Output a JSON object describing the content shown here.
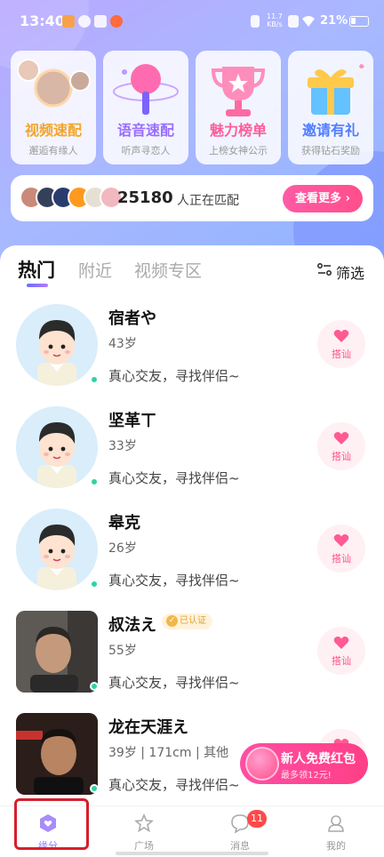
{
  "status_bar": {
    "time": "13:40",
    "net_speed_value": "11.7",
    "net_speed_unit": "KB/s",
    "battery": "21%"
  },
  "feature_cards": [
    {
      "title": "视频速配",
      "subtitle": "邂逅有缘人",
      "color": "#f3a52a"
    },
    {
      "title": "语音速配",
      "subtitle": "听声寻恋人",
      "color": "#9a6dff"
    },
    {
      "title": "魅力榜单",
      "subtitle": "上榜女神公示",
      "color": "#ff5c9a"
    },
    {
      "title": "邀请有礼",
      "subtitle": "获得钻石奖励",
      "color": "#4f7cff"
    }
  ],
  "match_bar": {
    "count": "25180",
    "label": "人正在匹配",
    "more_button": "查看更多"
  },
  "tabs": [
    "热门",
    "附近",
    "视频专区"
  ],
  "filter_label": "筛选",
  "users": [
    {
      "name": "宿者や",
      "age": "43岁",
      "bio": "真心交友，寻找伴侣~",
      "verified": false
    },
    {
      "name": "坚革ㄒ",
      "age": "33岁",
      "bio": "真心交友，寻找伴侣~",
      "verified": false
    },
    {
      "name": "皋克",
      "age": "26岁",
      "bio": "真心交友，寻找伴侣~",
      "verified": false
    },
    {
      "name": "叔法え",
      "age": "55岁",
      "bio": "真心交友，寻找伴侣~",
      "verified": true,
      "verified_label": "已认证"
    },
    {
      "name": "龙在天涯え",
      "age": "39岁 | 171cm | 其他",
      "bio": "真心交友，寻找伴侣~",
      "verified": false
    }
  ],
  "hi_button_label": "搭讪",
  "red_packet": {
    "title": "新人免费红包",
    "subtitle": "最多领12元!"
  },
  "bottom_nav": [
    {
      "label": "缘分",
      "icon": "heart-hex-icon",
      "active": true
    },
    {
      "label": "广场",
      "icon": "star-icon",
      "active": false
    },
    {
      "label": "消息",
      "icon": "chat-bubble-icon",
      "active": false,
      "badge": "11"
    },
    {
      "label": "我的",
      "icon": "profile-icon",
      "active": false
    }
  ],
  "colors": {
    "accent_pink": "#ff4f8b",
    "accent_purple": "#9b7cf8",
    "online_green": "#2ed2a3",
    "highlight_red": "#d61f2c"
  }
}
